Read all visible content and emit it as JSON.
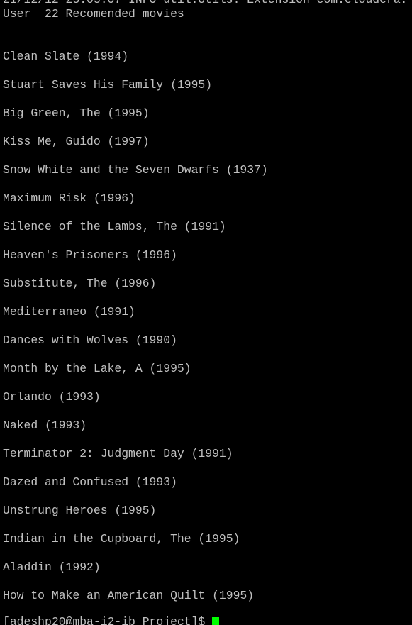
{
  "terminal": {
    "log_line": "21/12/12 23:03:07 INFO util.Utils: Extension com.cloudera.",
    "header": "User  22 Recomended movies",
    "movies": [
      "Clean Slate (1994)",
      "Stuart Saves His Family (1995)",
      "Big Green, The (1995)",
      "Kiss Me, Guido (1997)",
      "Snow White and the Seven Dwarfs (1937)",
      "Maximum Risk (1996)",
      "Silence of the Lambs, The (1991)",
      "Heaven's Prisoners (1996)",
      "Substitute, The (1996)",
      "Mediterraneo (1991)",
      "Dances with Wolves (1990)",
      "Month by the Lake, A (1995)",
      "Orlando (1993)",
      "Naked (1993)",
      "Terminator 2: Judgment Day (1991)",
      "Dazed and Confused (1993)",
      "Unstrung Heroes (1995)",
      "Indian in the Cupboard, The (1995)",
      "Aladdin (1992)",
      "How to Make an American Quilt (1995)"
    ],
    "prompt": "[adeshp20@mba-i2-ib Project]$ ",
    "colors": {
      "background": "#000000",
      "text": "#c0c0c0",
      "cursor": "#00ff00"
    }
  }
}
